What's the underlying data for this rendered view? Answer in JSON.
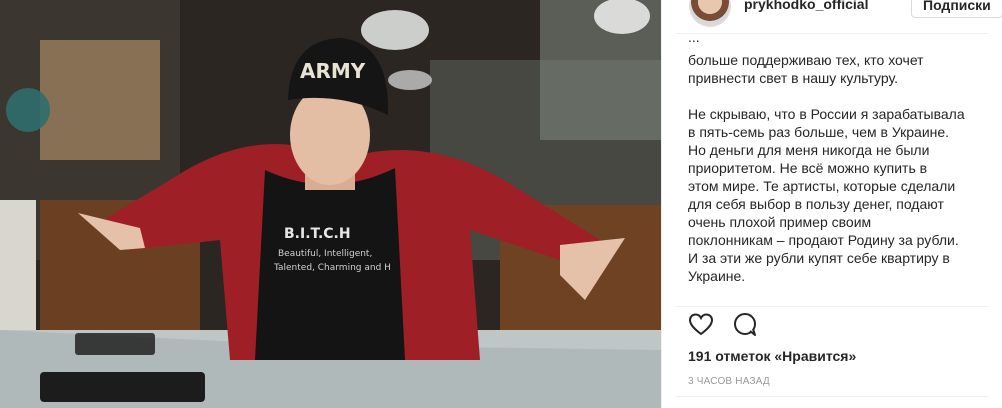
{
  "post": {
    "photo": {
      "cap_text": "ARMY",
      "shirt_line1": "B.I.T.C.H",
      "shirt_line2": "Beautiful, Intelligent,",
      "shirt_line3": "Talented, Charming and H"
    },
    "header": {
      "username": "prykhodko_official",
      "follow_label": "Подписки",
      "avatar_icon": "profile-avatar"
    },
    "caption": {
      "cut_line": "...",
      "paragraphs": [
        "больше поддерживаю тех, кто хочет\nпривнести свет в нашу культуру.",
        "Не скрываю, что в России я зарабатывала\nв пять-семь раз больше, чем в Украине.\nНо деньги для меня никогда не были\nприоритетом. Не всё можно купить в\nэтом мире. Те артисты, которые сделали\nдля себя выбор в пользу денег, подают\nочень плохой пример своим\nпоклонникам – продают Родину за рубли.\nИ за эти же рубли купят себе квартиру в\nУкраине."
      ]
    },
    "actions": {
      "like_icon": "heart-icon",
      "comment_icon": "comment-icon"
    },
    "likes_text": "191 отметок «Нравится»",
    "timestamp": "3 часов назад",
    "colors": {
      "text": "#262626",
      "muted": "#999999",
      "border": "#efefef",
      "jacket": "#9e1f26"
    }
  }
}
